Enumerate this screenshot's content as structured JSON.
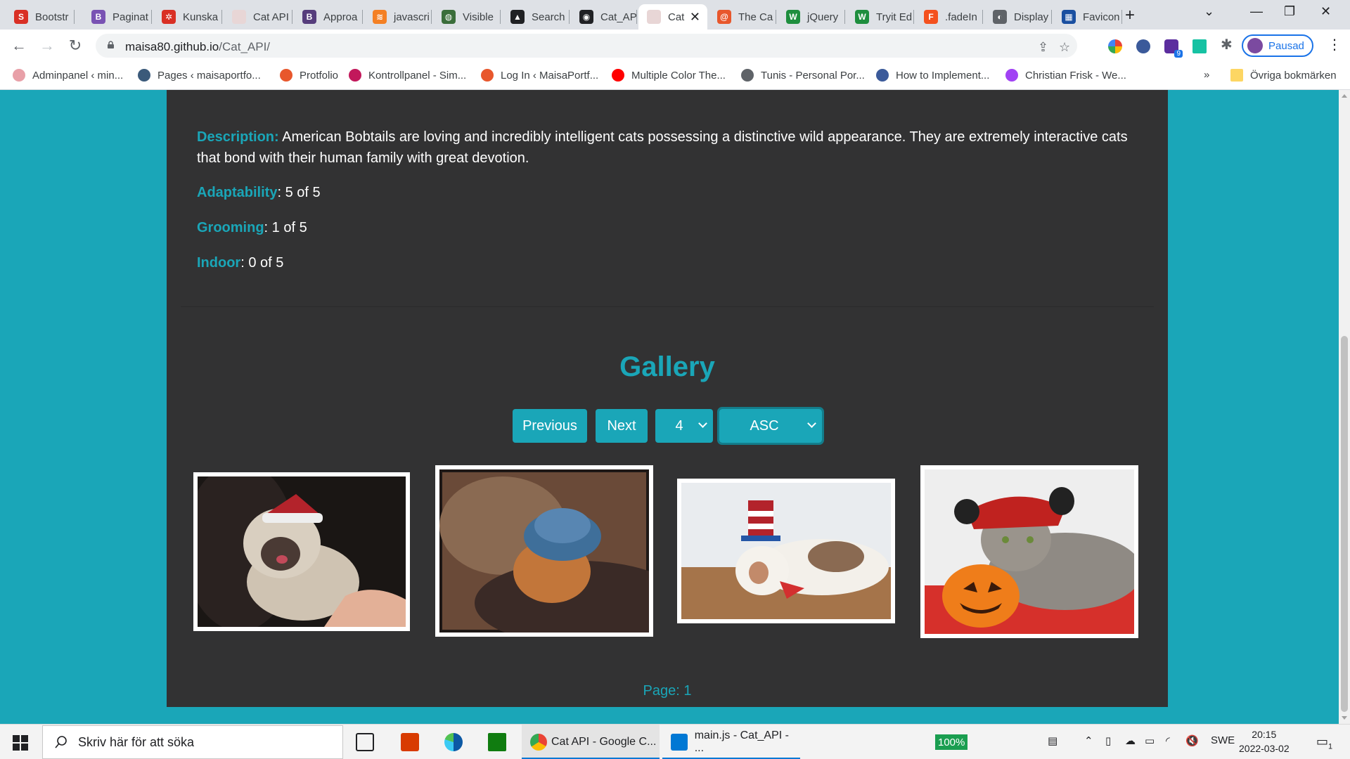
{
  "browser": {
    "tabs": [
      {
        "label": "Bootstr",
        "color": "#d93025",
        "glyph": "S"
      },
      {
        "label": "Paginat",
        "color": "#7952b3",
        "glyph": "B"
      },
      {
        "label": "Kunska",
        "color": "#d93025",
        "glyph": "✲"
      },
      {
        "label": "Cat API",
        "color": "#e8d6d6",
        "glyph": ""
      },
      {
        "label": "Approa",
        "color": "#563d7c",
        "glyph": "B"
      },
      {
        "label": "javascri",
        "color": "#f48024",
        "glyph": "≋"
      },
      {
        "label": "Visible",
        "color": "#3b6e3b",
        "glyph": "◍"
      },
      {
        "label": "Search",
        "color": "#202124",
        "glyph": "▲"
      },
      {
        "label": "Cat_AP",
        "color": "#202124",
        "glyph": "◉"
      },
      {
        "label": "Cat",
        "color": "#e8d6d6",
        "glyph": ""
      },
      {
        "label": "The Ca",
        "color": "#e8572c",
        "glyph": "@"
      },
      {
        "label": "jQuery",
        "color": "#1e8e3e",
        "glyph": "W"
      },
      {
        "label": "Tryit Ed",
        "color": "#1e8e3e",
        "glyph": "W"
      },
      {
        "label": ".fadeIn",
        "color": "#f4511e",
        "glyph": "F"
      },
      {
        "label": "Display",
        "color": "#5f6368",
        "glyph": "◐"
      },
      {
        "label": "Favicon",
        "color": "#1a4fa0",
        "glyph": "▦"
      }
    ],
    "active_tab": 9,
    "url_host": "maisa80.github.io",
    "url_path": "/Cat_API/",
    "profile_label": "Pausad",
    "extension_badge": "9",
    "bookmarks": [
      {
        "label": "Adminpanel ‹ min...",
        "color": "#e8a0a8"
      },
      {
        "label": "Pages ‹ maisaportfo...",
        "color": "#3b5a7a"
      },
      {
        "label": "Protfolio",
        "color": "#e8572c"
      },
      {
        "label": "Kontrollpanel - Sim...",
        "color": "#c2185b"
      },
      {
        "label": "Log In ‹ MaisaPortf...",
        "color": "#e8572c"
      },
      {
        "label": "Multiple Color The...",
        "color": "#ff0000"
      },
      {
        "label": "Tunis - Personal Por...",
        "color": "#5f6368"
      },
      {
        "label": "How to Implement...",
        "color": "#3b5a9a"
      },
      {
        "label": "Christian Frisk - We...",
        "color": "#a142f4"
      }
    ],
    "bookmarks_overflow": "»",
    "other_bookmarks": "Övriga bokmärken"
  },
  "breed": {
    "description_label": "Description:",
    "description": "American Bobtails are loving and incredibly intelligent cats possessing a distinctive wild appearance. They are extremely interactive cats that bond with their human family with great devotion.",
    "adaptability_label": "Adaptability",
    "adaptability": ": 5 of 5",
    "grooming_label": "Grooming",
    "grooming": ": 1 of 5",
    "indoor_label": "Indoor",
    "indoor": ": 0 of 5"
  },
  "gallery": {
    "title": "Gallery",
    "previous_label": "Previous",
    "next_label": "Next",
    "limit_value": "4",
    "order_value": "ASC",
    "page_label": "Page: 1",
    "images": [
      {
        "subject": "siamese cat in santa hat"
      },
      {
        "subject": "ginger cat in blue knitted hat"
      },
      {
        "subject": "calico cat in uncle sam hat"
      },
      {
        "subject": "tabby cat in devil hat with pumpkin"
      }
    ]
  },
  "taskbar": {
    "search_placeholder": "Skriv här för att söka",
    "apps": [
      {
        "label": "Cat API - Google C..."
      },
      {
        "label": "main.js - Cat_API - ..."
      }
    ],
    "zoom": "100%",
    "language": "SWE",
    "time": "20:15",
    "date": "2022-03-02",
    "notification_count": "1"
  },
  "colors": {
    "accent": "#1aa6b8",
    "card_background": "#323233",
    "page_background": "#1aa6b8"
  }
}
